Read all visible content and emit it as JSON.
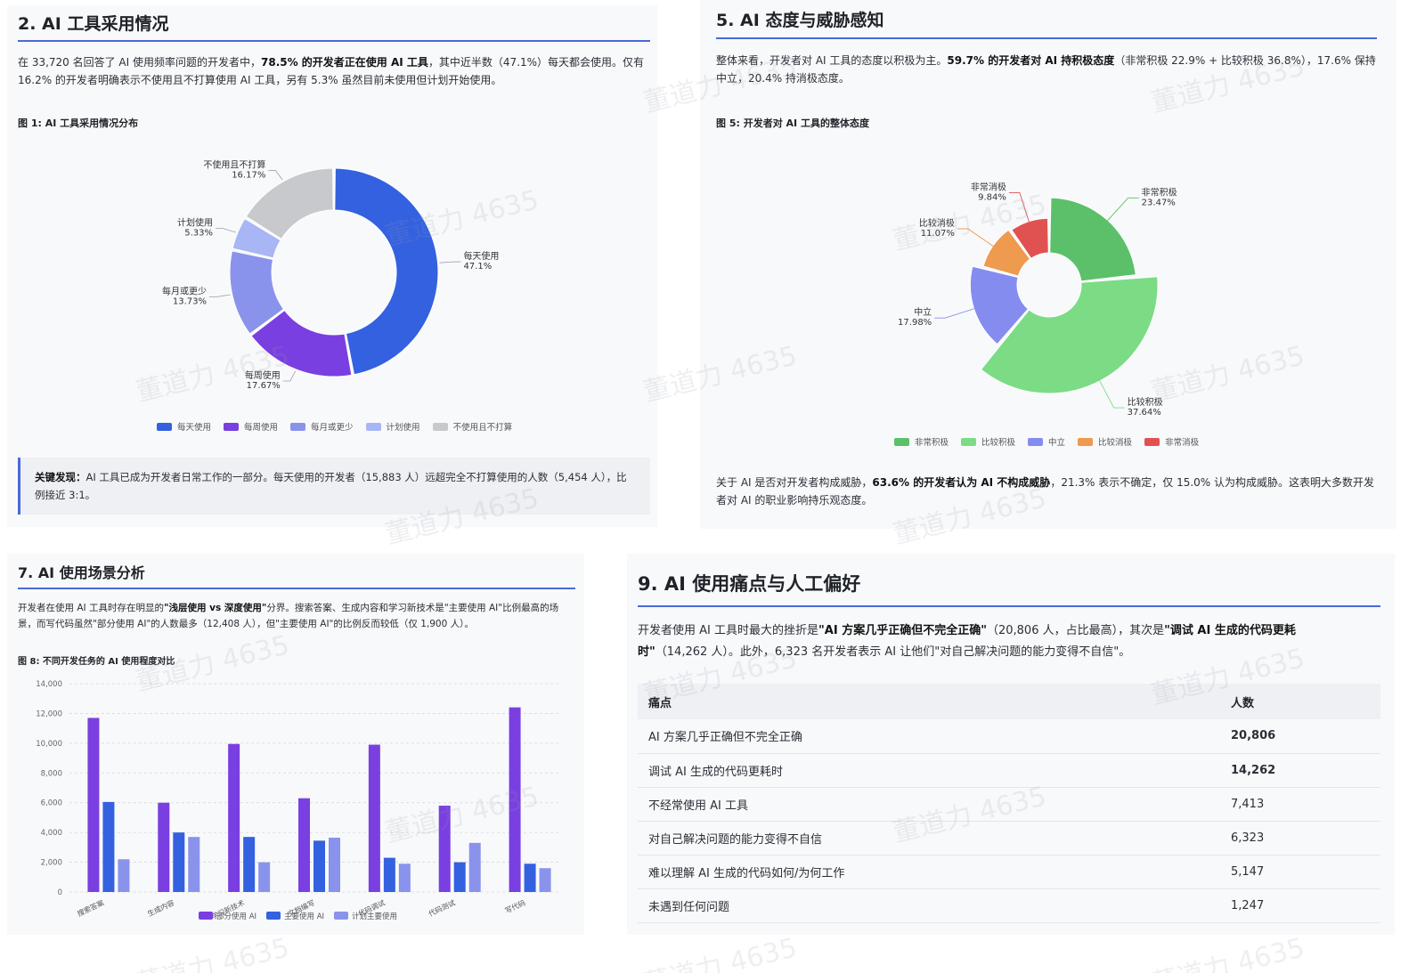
{
  "colors": {
    "accent": "#4a69d8",
    "daily": "#3461e0",
    "weekly": "#7a3fe0",
    "monthly": "#8a93ec",
    "plan": "#a8b6f5",
    "never": "#c8c9cd",
    "very_pos": "#5cc06a",
    "pos": "#7cdc86",
    "neutral": "#858cf0",
    "neg": "#ee9a4f",
    "very_neg": "#e05252"
  },
  "s2": {
    "title": "2. AI 工具采用情况",
    "para": [
      {
        "t": "在 33,720 名回答了 AI 使用频率问题的开发者中，",
        "b": false
      },
      {
        "t": "78.5% 的开发者正在使用 AI 工具",
        "b": true
      },
      {
        "t": "，其中近半数（47.1%）每天都会使用。仅有 16.2% 的开发者明确表示不使用且不打算使用 AI 工具，另有 5.3% 虽然目前未使用但计划开始使用。",
        "b": false
      }
    ],
    "fig_title": "图 1: AI 工具采用情况分布",
    "callout_label": "关键发现：",
    "callout_text": "AI 工具已成为开发者日常工作的一部分。每天使用的开发者（15,883 人）远超完全不打算使用的人数（5,454 人），比例接近 3:1。"
  },
  "s5": {
    "title": "5. AI 态度与威胁感知",
    "para": [
      {
        "t": "整体来看，开发者对 AI 工具的态度以积极为主。",
        "b": false
      },
      {
        "t": "59.7% 的开发者对 AI 持积极态度",
        "b": true
      },
      {
        "t": "（非常积极 22.9% + 比较积极 36.8%），17.6% 保持中立，20.4% 持消极态度。",
        "b": false
      }
    ],
    "fig_title": "图 5: 开发者对 AI 工具的整体态度",
    "para2": [
      {
        "t": "关于 AI 是否对开发者构成威胁，",
        "b": false
      },
      {
        "t": "63.6% 的开发者认为 AI 不构成威胁",
        "b": true
      },
      {
        "t": "，21.3% 表示不确定，仅 15.0% 认为构成威胁。这表明大多数开发者对 AI 的职业影响持乐观态度。",
        "b": false
      }
    ]
  },
  "s7": {
    "title": "7. AI 使用场景分析",
    "para": [
      {
        "t": "开发者在使用 AI 工具时存在明显的",
        "b": false
      },
      {
        "t": "\"浅层使用 vs 深度使用\"",
        "b": true
      },
      {
        "t": "分界。搜索答案、生成内容和学习新技术是\"主要使用 AI\"比例最高的场景，而写代码虽然\"部分使用 AI\"的人数最多（12,408 人），但\"主要使用 AI\"的比例反而较低（仅 1,900 人）。",
        "b": false
      }
    ],
    "fig_title": "图 8: 不同开发任务的 AI 使用程度对比"
  },
  "s9": {
    "title": "9. AI 使用痛点与人工偏好",
    "para": [
      {
        "t": "开发者使用 AI 工具时最大的挫折是",
        "b": false
      },
      {
        "t": "\"AI 方案几乎正确但不完全正确\"",
        "b": true
      },
      {
        "t": "（20,806 人，占比最高），其次是",
        "b": false
      },
      {
        "t": "\"调试 AI 生成的代码更耗时\"",
        "b": true
      },
      {
        "t": "（14,262 人）。此外，6,323 名开发者表示 AI 让他们\"对自己解决问题的能力变得不自信\"。",
        "b": false
      }
    ],
    "table": {
      "headers": [
        "痛点",
        "人数"
      ],
      "rows": [
        {
          "label": "AI 方案几乎正确但不完全正确",
          "count": "20,806",
          "bold": true
        },
        {
          "label": "调试 AI 生成的代码更耗时",
          "count": "14,262",
          "bold": true
        },
        {
          "label": "不经常使用 AI 工具",
          "count": "7,413",
          "bold": false
        },
        {
          "label": "对自己解决问题的能力变得不自信",
          "count": "6,323",
          "bold": false
        },
        {
          "label": "难以理解 AI 生成的代码如何/为何工作",
          "count": "5,147",
          "bold": false
        },
        {
          "label": "未遇到任何问题",
          "count": "1,247",
          "bold": false
        }
      ]
    }
  },
  "watermark": "董道力 4635",
  "chart_data": [
    {
      "type": "pie",
      "title": "图 1: AI 工具采用情况分布",
      "categories": [
        "每天使用",
        "每周使用",
        "每月或更少",
        "计划使用",
        "不使用且不打算"
      ],
      "values": [
        47.1,
        17.67,
        13.73,
        5.33,
        16.17
      ],
      "value_labels": [
        "47.1%",
        "17.67%",
        "13.73%",
        "5.33%",
        "16.17%"
      ],
      "colors": [
        "#3461e0",
        "#7a3fe0",
        "#8a93ec",
        "#a8b6f5",
        "#c8c9cd"
      ],
      "legend": "bottom"
    },
    {
      "type": "pie",
      "title": "图 5: 开发者对 AI 工具的整体态度",
      "categories": [
        "非常积极",
        "比较积极",
        "中立",
        "比较消极",
        "非常消极"
      ],
      "values": [
        23.47,
        37.64,
        17.98,
        11.07,
        9.84
      ],
      "value_labels": [
        "23.47%",
        "37.64%",
        "17.98%",
        "11.07%",
        "9.84%"
      ],
      "colors": [
        "#5cc06a",
        "#7cdc86",
        "#858cf0",
        "#ee9a4f",
        "#e05252"
      ],
      "legend": "bottom"
    },
    {
      "type": "bar",
      "title": "图 8: 不同开发任务的 AI 使用程度对比",
      "categories": [
        "搜索答案",
        "生成内容",
        "学习新技术",
        "文档编写",
        "代码调试",
        "代码测试",
        "写代码"
      ],
      "series": [
        {
          "name": "部分使用 AI",
          "values": [
            11700,
            6000,
            9950,
            6300,
            9900,
            5800,
            12408
          ],
          "color": "#7a3fe0"
        },
        {
          "name": "主要使用 AI",
          "values": [
            6050,
            4000,
            3700,
            3450,
            2300,
            2000,
            1900
          ],
          "color": "#3461e0"
        },
        {
          "name": "计划主要使用",
          "values": [
            2200,
            3700,
            2000,
            3650,
            1900,
            3300,
            1600
          ],
          "color": "#8a93ec"
        }
      ],
      "ylim": [
        0,
        14000
      ],
      "yticks": [
        "0",
        "2,000",
        "4,000",
        "6,000",
        "8,000",
        "10,000",
        "12,000",
        "14,000"
      ],
      "grid": true,
      "legend": "bottom"
    }
  ]
}
